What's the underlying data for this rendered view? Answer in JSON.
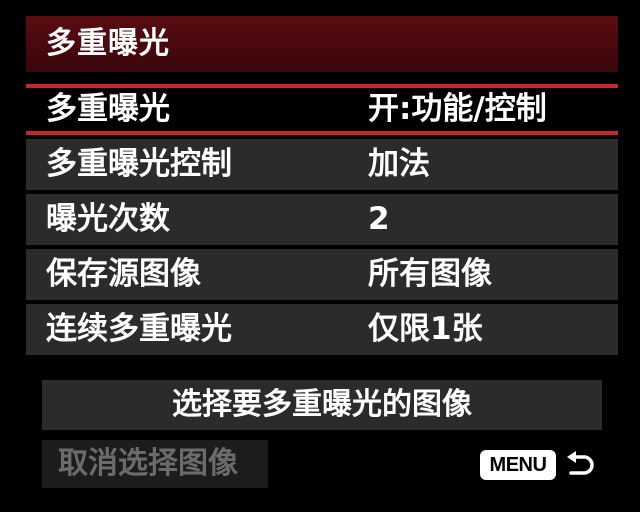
{
  "header": {
    "title": "多重曝光"
  },
  "menu": {
    "items": [
      {
        "label": "多重曝光",
        "value": "开:功能/控制",
        "selected": true
      },
      {
        "label": "多重曝光控制",
        "value": "加法"
      },
      {
        "label": "曝光次数",
        "value": "2"
      },
      {
        "label": "保存源图像",
        "value": "所有图像"
      },
      {
        "label": "连续多重曝光",
        "value": "仅限1张"
      }
    ]
  },
  "actions": {
    "select_images": "选择要多重曝光的图像",
    "deselect_images": "取消选择图像"
  },
  "footer": {
    "menu_button_label": "MENU",
    "return_icon": "return-arrow-icon"
  },
  "colors": {
    "title_bar": "#4a0a10",
    "selection_border": "#c8262c",
    "row_background": "#2b2b2b",
    "disabled_text": "#6b6b6b"
  }
}
